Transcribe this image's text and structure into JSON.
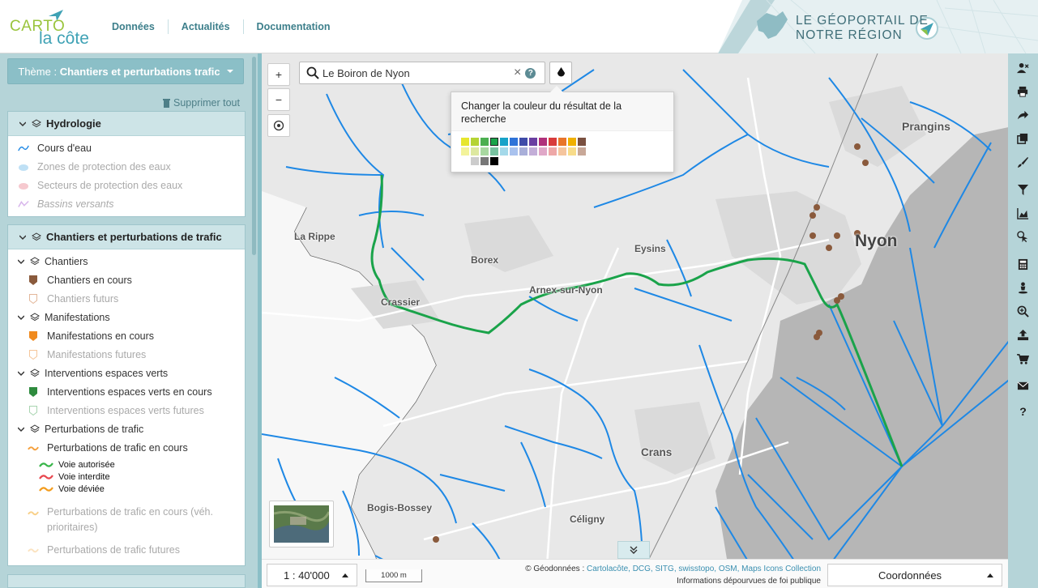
{
  "header": {
    "logo_carto": "CARTO",
    "logo_lacote": "la côte",
    "nav": [
      "Données",
      "Actualités",
      "Documentation"
    ],
    "brand_line1": "LE GÉOPORTAIL DE",
    "brand_line2": "NOTRE RÉGION"
  },
  "sidebar": {
    "theme_prefix": "Thème : ",
    "theme_value": "Chantiers et perturbations trafic",
    "delete_all": "Supprimer tout",
    "groups": [
      {
        "title": "Hydrologie",
        "items": [
          {
            "label": "Cours d'eau",
            "icon": "river-line-icon",
            "active": true
          },
          {
            "label": "Zones de protection des eaux",
            "icon": "cloud-zone-icon",
            "active": false
          },
          {
            "label": "Secteurs de protection des eaux",
            "icon": "cloud-sector-icon",
            "active": false
          },
          {
            "label": "Bassins versants",
            "icon": "basin-line-icon",
            "active": false
          }
        ]
      },
      {
        "title": "Chantiers et perturbations de trafic",
        "subgroups": [
          {
            "title": "Chantiers",
            "items": [
              {
                "label": "Chantiers en cours",
                "color": "#8a5a3c",
                "active": true
              },
              {
                "label": "Chantiers futurs",
                "color": "#e3b79a",
                "active": false
              }
            ]
          },
          {
            "title": "Manifestations",
            "items": [
              {
                "label": "Manifestations en cours",
                "color": "#f08a1e",
                "active": true
              },
              {
                "label": "Manifestations futures",
                "color": "#f5c69a",
                "active": false
              }
            ]
          },
          {
            "title": "Interventions espaces verts",
            "items": [
              {
                "label": "Interventions espaces verts en cours",
                "color": "#2e8b3e",
                "active": true
              },
              {
                "label": "Interventions espaces verts futures",
                "color": "#a8d4b0",
                "active": false
              }
            ]
          },
          {
            "title": "Perturbations de trafic",
            "items": [
              {
                "label": "Perturbations de trafic en cours",
                "color": "#f5a03c",
                "active": true
              }
            ]
          }
        ],
        "traffic_legend": [
          {
            "label": "Voie autorisée",
            "color": "#39b54a"
          },
          {
            "label": "Voie interdite",
            "color": "#e8474f"
          },
          {
            "label": "Voie déviée",
            "color": "#f39c1d"
          }
        ],
        "more_items": [
          {
            "label": "Perturbations de trafic en cours (véh. prioritaires)",
            "color": "#f8d088"
          },
          {
            "label": "Perturbations de trafic futures",
            "color": "#fbe3c0"
          }
        ]
      }
    ]
  },
  "map": {
    "zoom_in": "+",
    "zoom_out": "−",
    "search_value": "Le Boiron de Nyon",
    "search_clear": "×",
    "search_help": "?",
    "popover_title": "Changer la couleur du résultat de la recherche",
    "places": [
      "Prangins",
      "Nyon",
      "La Rippe",
      "Borex",
      "Eysins",
      "Arnex-sur-Nyon",
      "Crassier",
      "Crans",
      "Bogis-Bossey",
      "Céligny"
    ],
    "colors": {
      "river": "#1e88e5",
      "search_result": "#1aa34a",
      "lake": "#b4b4b4",
      "land": "#e9e9e9"
    }
  },
  "bottombar": {
    "scale": "1 : 40'000",
    "scalebar": "1000 m",
    "attribution_prefix": "© Géodonnées : ",
    "attribution_links": "Cartolacôte, DCG, SITG, swisstopo, OSM, Maps Icons Collection",
    "attribution_note": "Informations dépourvues de foi publique",
    "coordinates": "Coordonnées"
  },
  "toolbar": [
    "user-remove-icon",
    "print-icon",
    "share-icon",
    "copy-icon",
    "brush-icon",
    "filter-icon",
    "chart-icon",
    "select-icon",
    "calculator-icon",
    "person-icon",
    "zoom-icon",
    "upload-icon",
    "cart-icon",
    "mail-icon",
    "help-icon"
  ]
}
